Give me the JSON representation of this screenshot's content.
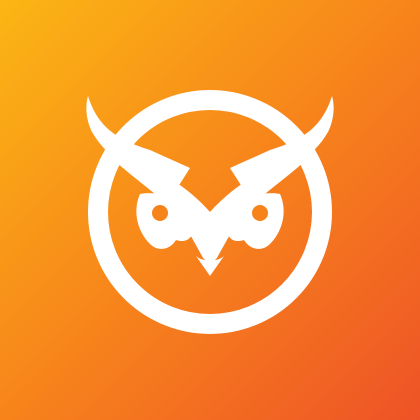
{
  "icon": {
    "name": "owl-logo-icon",
    "glyph": "owl-face-in-ring",
    "gradient": {
      "start": "#FBB614",
      "mid": "#F7841B",
      "end": "#EE5327"
    },
    "foreground": "#FFFFFF"
  }
}
